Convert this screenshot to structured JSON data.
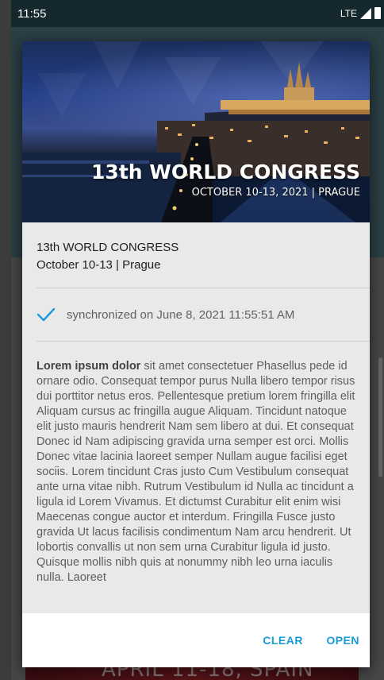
{
  "status_bar": {
    "time": "11:55",
    "network": "LTE",
    "signal_icon": "signal-icon",
    "battery_icon": "battery-icon"
  },
  "background": {
    "banner_text": "APRIL 11-18, SPAIN"
  },
  "dialog": {
    "hero": {
      "title": "13th WORLD CONGRESS",
      "subtitle": "OCTOBER 10-13, 2021 | PRAGUE"
    },
    "event_title": "13th WORLD CONGRESS",
    "event_date": "October 10-13 | Prague",
    "sync": {
      "icon": "check-icon",
      "text": "synchronized on June 8, 2021 11:55:51 AM"
    },
    "description": {
      "lead": "Lorem ipsum dolor",
      "text": " sit amet consectetuer Phasellus pede id ornare odio. Consequat tempor purus Nulla libero tempor risus dui porttitor netus eros. Pellentesque pretium lorem fringilla elit Aliquam cursus ac fringilla augue Aliquam. Tincidunt natoque elit justo mauris hendrerit Nam sem libero at dui. Et consequat Donec id Nam adipiscing gravida urna semper est orci. Mollis Donec vitae lacinia laoreet semper Nullam augue facilisi eget sociis. Lorem tincidunt Cras justo Cum Vestibulum consequat ante urna vitae nibh. Rutrum Vestibulum id Nulla ac tincidunt a ligula id Lorem Vivamus. Et dictumst Curabitur elit enim wisi Maecenas congue auctor et interdum. Fringilla Fusce justo gravida Ut lacus facilisis condimentum Nam arcu hendrerit. Ut lobortis convallis ut non sem urna Curabitur ligula id justo. Quisque mollis nibh quis at nonummy nibh leo urna iaculis nulla. Laoreet"
    },
    "actions": {
      "clear_label": "CLEAR",
      "open_label": "OPEN"
    }
  },
  "colors": {
    "accent": "#1a9ad6",
    "status_bar": "#14282e",
    "dialog_bg": "#e9e9e9"
  }
}
